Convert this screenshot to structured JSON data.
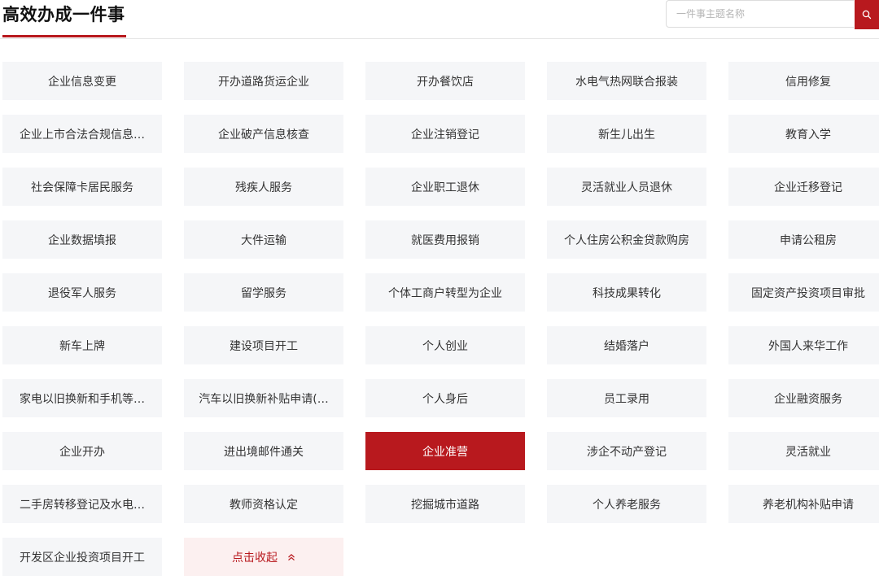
{
  "header": {
    "title": "高效办成一件事",
    "search_placeholder": "一件事主题名称"
  },
  "items": [
    {
      "label": "企业信息变更"
    },
    {
      "label": "开办道路货运企业"
    },
    {
      "label": "开办餐饮店"
    },
    {
      "label": "水电气热网联合报装"
    },
    {
      "label": "信用修复"
    },
    {
      "label": "企业上市合法合规信息…"
    },
    {
      "label": "企业破产信息核查"
    },
    {
      "label": "企业注销登记"
    },
    {
      "label": "新生儿出生"
    },
    {
      "label": "教育入学"
    },
    {
      "label": "社会保障卡居民服务"
    },
    {
      "label": "残疾人服务"
    },
    {
      "label": "企业职工退休"
    },
    {
      "label": "灵活就业人员退休"
    },
    {
      "label": "企业迁移登记"
    },
    {
      "label": "企业数据填报"
    },
    {
      "label": "大件运输"
    },
    {
      "label": "就医费用报销"
    },
    {
      "label": "个人住房公积金贷款购房"
    },
    {
      "label": "申请公租房"
    },
    {
      "label": "退役军人服务"
    },
    {
      "label": "留学服务"
    },
    {
      "label": "个体工商户转型为企业"
    },
    {
      "label": "科技成果转化"
    },
    {
      "label": "固定资产投资项目审批"
    },
    {
      "label": "新车上牌"
    },
    {
      "label": "建设项目开工"
    },
    {
      "label": "个人创业"
    },
    {
      "label": "结婚落户"
    },
    {
      "label": "外国人来华工作"
    },
    {
      "label": "家电以旧换新和手机等…"
    },
    {
      "label": "汽车以旧换新补贴申请(…"
    },
    {
      "label": "个人身后"
    },
    {
      "label": "员工录用"
    },
    {
      "label": "企业融资服务"
    },
    {
      "label": "企业开办"
    },
    {
      "label": "进出境邮件通关"
    },
    {
      "label": "企业准营"
    },
    {
      "label": "涉企不动产登记"
    },
    {
      "label": "灵活就业"
    },
    {
      "label": "二手房转移登记及水电…"
    },
    {
      "label": "教师资格认定"
    },
    {
      "label": "挖掘城市道路"
    },
    {
      "label": "个人养老服务"
    },
    {
      "label": "养老机构补贴申请"
    },
    {
      "label": "开发区企业投资项目开工"
    }
  ],
  "active_index": 37,
  "collapse_label": "点击收起",
  "colors": {
    "accent": "#b8191e",
    "tile_bg": "#f5f6f8",
    "collapse_bg": "#fcf0f0"
  }
}
